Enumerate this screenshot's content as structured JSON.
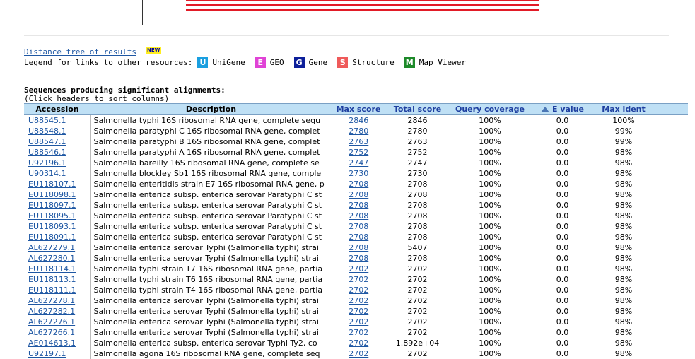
{
  "links": {
    "distance_tree": "Distance tree of results",
    "new_badge": "NEW"
  },
  "legend": {
    "label": "Legend for links to other resources:",
    "resources": [
      {
        "letter": "U",
        "name": "UniGene",
        "color": "#1a9fe0",
        "icon": "unigene-icon"
      },
      {
        "letter": "E",
        "name": "GEO",
        "color": "#e043d6",
        "icon": "geo-icon"
      },
      {
        "letter": "G",
        "name": "Gene",
        "color": "#0d1f9a",
        "icon": "gene-icon"
      },
      {
        "letter": "S",
        "name": "Structure",
        "color": "#ef5a5a",
        "icon": "structure-icon"
      },
      {
        "letter": "M",
        "name": "Map Viewer",
        "color": "#1e8a2a",
        "icon": "map-viewer-icon"
      }
    ]
  },
  "sequences": {
    "title": "Sequences producing significant alignments:",
    "hint": "(Click headers to sort columns)"
  },
  "table": {
    "headers": {
      "accession": "Accession",
      "description": "Description",
      "max_score": "Max score",
      "total_score": "Total score",
      "query_coverage": "Query coverage",
      "e_value": "E value",
      "max_ident": "Max ident"
    },
    "rows": [
      {
        "acc": "U88545.1",
        "desc": "Salmonella typhi 16S ribosomal RNA gene, complete sequ",
        "max": "2846",
        "total": "2846",
        "cov": "100%",
        "e": "0.0",
        "ident": "100%"
      },
      {
        "acc": "U88548.1",
        "desc": "Salmonella paratyphi C 16S ribosomal RNA gene, complet",
        "max": "2780",
        "total": "2780",
        "cov": "100%",
        "e": "0.0",
        "ident": "99%"
      },
      {
        "acc": "U88547.1",
        "desc": "Salmonella paratyphi B 16S ribosomal RNA gene, complet",
        "max": "2763",
        "total": "2763",
        "cov": "100%",
        "e": "0.0",
        "ident": "99%"
      },
      {
        "acc": "U88546.1",
        "desc": "Salmonella paratyphi A 16S ribosomal RNA gene, complet",
        "max": "2752",
        "total": "2752",
        "cov": "100%",
        "e": "0.0",
        "ident": "98%"
      },
      {
        "acc": "U92196.1",
        "desc": "Salmonella bareilly 16S ribosomal RNA gene, complete se",
        "max": "2747",
        "total": "2747",
        "cov": "100%",
        "e": "0.0",
        "ident": "98%"
      },
      {
        "acc": "U90314.1",
        "desc": "Salmonella blockley Sb1 16S ribosomal RNA gene, comple",
        "max": "2730",
        "total": "2730",
        "cov": "100%",
        "e": "0.0",
        "ident": "98%"
      },
      {
        "acc": "EU118107.1",
        "desc": "Salmonella enteritidis strain E7 16S ribosomal RNA gene, p",
        "max": "2708",
        "total": "2708",
        "cov": "100%",
        "e": "0.0",
        "ident": "98%"
      },
      {
        "acc": "EU118098.1",
        "desc": "Salmonella enterica subsp. enterica serovar Paratyphi C st",
        "max": "2708",
        "total": "2708",
        "cov": "100%",
        "e": "0.0",
        "ident": "98%"
      },
      {
        "acc": "EU118097.1",
        "desc": "Salmonella enterica subsp. enterica serovar Paratyphi C st",
        "max": "2708",
        "total": "2708",
        "cov": "100%",
        "e": "0.0",
        "ident": "98%"
      },
      {
        "acc": "EU118095.1",
        "desc": "Salmonella enterica subsp. enterica serovar Paratyphi C st",
        "max": "2708",
        "total": "2708",
        "cov": "100%",
        "e": "0.0",
        "ident": "98%"
      },
      {
        "acc": "EU118093.1",
        "desc": "Salmonella enterica subsp. enterica serovar Paratyphi C st",
        "max": "2708",
        "total": "2708",
        "cov": "100%",
        "e": "0.0",
        "ident": "98%"
      },
      {
        "acc": "EU118091.1",
        "desc": "Salmonella enterica subsp. enterica serovar Paratyphi C st",
        "max": "2708",
        "total": "2708",
        "cov": "100%",
        "e": "0.0",
        "ident": "98%"
      },
      {
        "acc": "AL627279.1",
        "desc": "Salmonella enterica serovar Typhi (Salmonella typhi) strai",
        "max": "2708",
        "total": "5407",
        "cov": "100%",
        "e": "0.0",
        "ident": "98%"
      },
      {
        "acc": "AL627280.1",
        "desc": "Salmonella enterica serovar Typhi (Salmonella typhi) strai",
        "max": "2708",
        "total": "2708",
        "cov": "100%",
        "e": "0.0",
        "ident": "98%"
      },
      {
        "acc": "EU118114.1",
        "desc": "Salmonella typhi strain T7 16S ribosomal RNA gene, partia",
        "max": "2702",
        "total": "2702",
        "cov": "100%",
        "e": "0.0",
        "ident": "98%"
      },
      {
        "acc": "EU118113.1",
        "desc": "Salmonella typhi strain T6 16S ribosomal RNA gene, partia",
        "max": "2702",
        "total": "2702",
        "cov": "100%",
        "e": "0.0",
        "ident": "98%"
      },
      {
        "acc": "EU118111.1",
        "desc": "Salmonella typhi strain T4 16S ribosomal RNA gene, partia",
        "max": "2702",
        "total": "2702",
        "cov": "100%",
        "e": "0.0",
        "ident": "98%"
      },
      {
        "acc": "AL627278.1",
        "desc": "Salmonella enterica serovar Typhi (Salmonella typhi) strai",
        "max": "2702",
        "total": "2702",
        "cov": "100%",
        "e": "0.0",
        "ident": "98%"
      },
      {
        "acc": "AL627282.1",
        "desc": "Salmonella enterica serovar Typhi (Salmonella typhi) strai",
        "max": "2702",
        "total": "2702",
        "cov": "100%",
        "e": "0.0",
        "ident": "98%"
      },
      {
        "acc": "AL627276.1",
        "desc": "Salmonella enterica serovar Typhi (Salmonella typhi) strai",
        "max": "2702",
        "total": "2702",
        "cov": "100%",
        "e": "0.0",
        "ident": "98%"
      },
      {
        "acc": "AL627266.1",
        "desc": "Salmonella enterica serovar Typhi (Salmonella typhi) strai",
        "max": "2702",
        "total": "2702",
        "cov": "100%",
        "e": "0.0",
        "ident": "98%"
      },
      {
        "acc": "AE014613.1",
        "desc": "Salmonella enterica subsp. enterica serovar Typhi Ty2, co",
        "max": "2702",
        "total": "1.892e+04",
        "cov": "100%",
        "e": "0.0",
        "ident": "98%"
      },
      {
        "acc": "U92197.1",
        "desc": "Salmonella agona 16S ribosomal RNA gene, complete seq",
        "max": "2702",
        "total": "2702",
        "cov": "100%",
        "e": "0.0",
        "ident": "98%"
      }
    ]
  },
  "colors": {
    "header_bg": "#bfe0f5",
    "link": "#1e57a3",
    "hit_bar": "#e21b27"
  }
}
